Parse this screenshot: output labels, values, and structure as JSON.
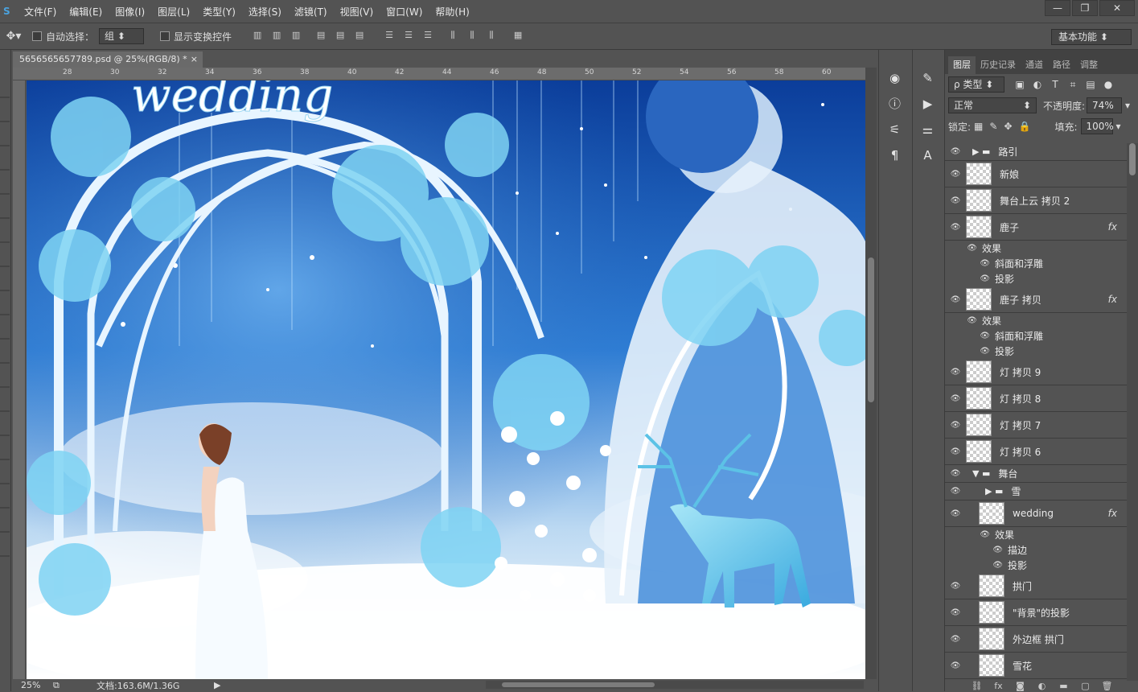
{
  "menu": {
    "items": [
      "文件(F)",
      "编辑(E)",
      "图像(I)",
      "图层(L)",
      "类型(Y)",
      "选择(S)",
      "滤镜(T)",
      "视图(V)",
      "窗口(W)",
      "帮助(H)"
    ]
  },
  "window_buttons": [
    "—",
    "❐",
    "✕"
  ],
  "options": {
    "auto_select_label": "自动选择：",
    "auto_select_value": "组",
    "transform_label": "显示变换控件",
    "workspace": "基本功能"
  },
  "document": {
    "tab_title": "5656565657789.psd @ 25%(RGB/8) *",
    "close": "×",
    "ruler_ticks": [
      "28",
      "30",
      "32",
      "34",
      "36",
      "38",
      "40",
      "42",
      "44",
      "46",
      "48",
      "50",
      "52",
      "54",
      "56",
      "58",
      "60"
    ]
  },
  "canvas_text": {
    "title_art": "wedding"
  },
  "status": {
    "zoom": "25%",
    "doc": "文档:163.6M/1.36G"
  },
  "panel": {
    "tabs": [
      "图层",
      "历史记录",
      "通道",
      "路径",
      "调整"
    ],
    "filter_kind": "ρ 类型",
    "blend_mode": "正常",
    "opacity_label": "不透明度:",
    "opacity_value": "74%",
    "lock_label": "锁定:",
    "fill_label": "填充:",
    "fill_value": "100%"
  },
  "layers": [
    {
      "name": "路引",
      "kind": "group"
    },
    {
      "name": "新娘",
      "kind": "layer"
    },
    {
      "name": "舞台上云 拷贝 2",
      "kind": "layer"
    },
    {
      "name": "鹿子",
      "kind": "layer",
      "fx": "fx"
    },
    {
      "name": "效果",
      "kind": "effect-head"
    },
    {
      "name": "斜面和浮雕",
      "kind": "effect"
    },
    {
      "name": "投影",
      "kind": "effect"
    },
    {
      "name": "鹿子 拷贝",
      "kind": "layer",
      "fx": "fx"
    },
    {
      "name": "效果",
      "kind": "effect-head"
    },
    {
      "name": "斜面和浮雕",
      "kind": "effect"
    },
    {
      "name": "投影",
      "kind": "effect"
    },
    {
      "name": "灯 拷贝 9",
      "kind": "layer"
    },
    {
      "name": "灯 拷贝 8",
      "kind": "layer"
    },
    {
      "name": "灯 拷贝 7",
      "kind": "layer"
    },
    {
      "name": "灯 拷贝 6",
      "kind": "layer"
    },
    {
      "name": "舞台",
      "kind": "group-open"
    },
    {
      "name": "雪",
      "kind": "subgroup"
    },
    {
      "name": "wedding",
      "kind": "sublayer",
      "fx": "fx"
    },
    {
      "name": "效果",
      "kind": "sub-effect-head"
    },
    {
      "name": "描边",
      "kind": "sub-effect"
    },
    {
      "name": "投影",
      "kind": "sub-effect"
    },
    {
      "name": "拱门",
      "kind": "sublayer"
    },
    {
      "name": "\"背景\"的投影",
      "kind": "sublayer"
    },
    {
      "name": "外边框 拱门",
      "kind": "sublayer"
    },
    {
      "name": "雪花",
      "kind": "sublayer"
    }
  ],
  "footer_icons": [
    "link-icon",
    "fx-icon",
    "mask-icon",
    "adjustment-icon",
    "folder-icon",
    "new-layer-icon",
    "trash-icon"
  ]
}
